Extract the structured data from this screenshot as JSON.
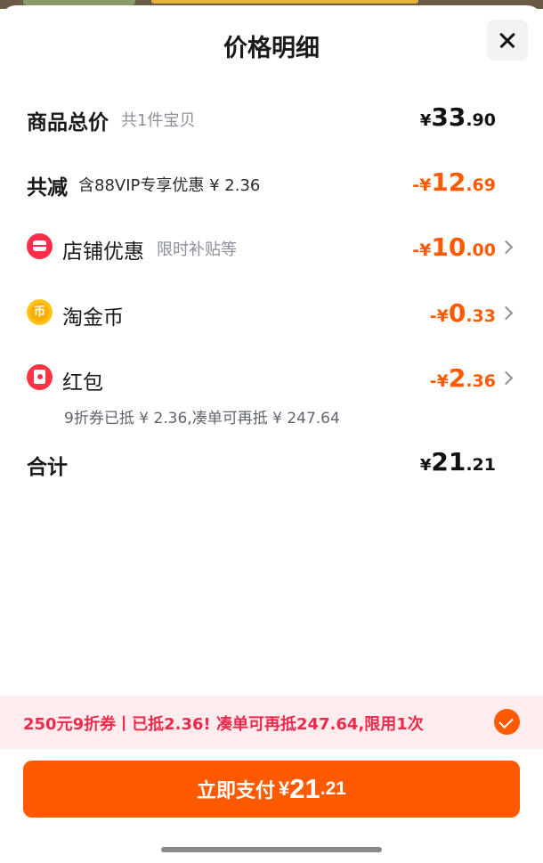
{
  "title": "价格明细",
  "rows": {
    "total": {
      "label": "商品总价",
      "sub": "共1件宝贝",
      "symbol": "¥",
      "int": "33",
      "dec": ".90"
    },
    "reduce": {
      "label": "共减",
      "sub": "含88VIP专享优惠 ¥ 2.36",
      "minus": "-",
      "symbol": "¥",
      "int": "12",
      "dec": ".69"
    },
    "store": {
      "label": "店铺优惠",
      "sub": "限时补贴等",
      "minus": "-",
      "symbol": "¥",
      "int": "10",
      "dec": ".00"
    },
    "coin": {
      "label": "淘金币",
      "glyph": "币",
      "minus": "-",
      "symbol": "¥",
      "int": "0",
      "dec": ".33"
    },
    "redpacket": {
      "label": "红包",
      "note": "9折券已抵 ¥ 2.36,凑单可再抵 ¥ 247.64",
      "minus": "-",
      "symbol": "¥",
      "int": "2",
      "dec": ".36"
    },
    "sum": {
      "label": "合计",
      "symbol": "¥",
      "int": "21",
      "dec": ".21"
    }
  },
  "coupon": {
    "text": "250元9折券丨已抵2.36! 凑单可再抵247.64,限用1次",
    "checked": true
  },
  "pay": {
    "label": "立即支付",
    "symbol": "¥",
    "int": "21",
    "dec": ".21"
  },
  "colors": {
    "accent": "#ff5a00",
    "coupon_text": "#f0284a",
    "coupon_bg": "#ffecef"
  },
  "icons": {
    "close": "close-icon",
    "store": "store-icon",
    "coin": "coin-icon",
    "redpacket": "red-packet-icon",
    "check": "check-circle-icon",
    "chevron": "chevron-right-icon"
  }
}
